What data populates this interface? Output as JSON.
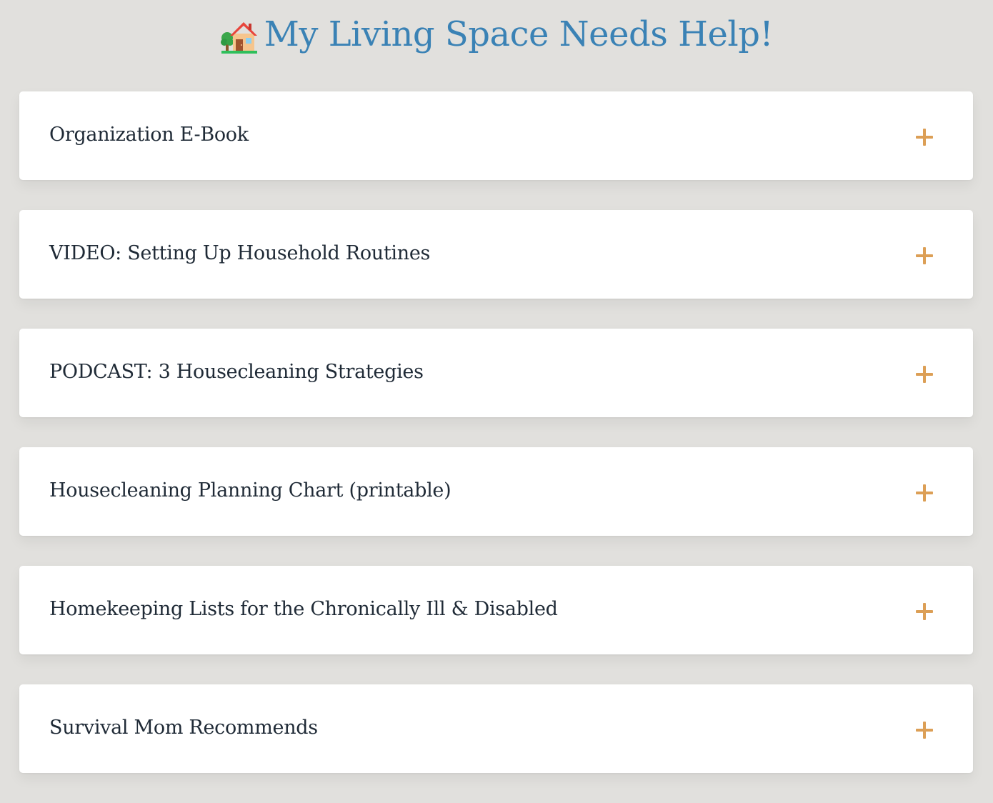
{
  "header": {
    "icon": "house-with-garden-icon",
    "title": "My Living Space Needs Help!"
  },
  "accordion": {
    "items": [
      {
        "label": "Organization E-Book",
        "icon": "plus-icon"
      },
      {
        "label": "VIDEO: Setting Up Household Routines",
        "icon": "plus-icon"
      },
      {
        "label": "PODCAST: 3 Housecleaning Strategies",
        "icon": "plus-icon"
      },
      {
        "label": "Housecleaning Planning Chart (printable)",
        "icon": "plus-icon"
      },
      {
        "label": "Homekeeping Lists for the Chronically Ill & Disabled",
        "icon": "plus-icon"
      },
      {
        "label": "Survival Mom Recommends",
        "icon": "plus-icon"
      }
    ]
  },
  "colors": {
    "background": "#e1e0dd",
    "title": "#3a82b5",
    "text": "#1f2a36",
    "accent_plus": "#dc9f56",
    "card": "#ffffff"
  }
}
